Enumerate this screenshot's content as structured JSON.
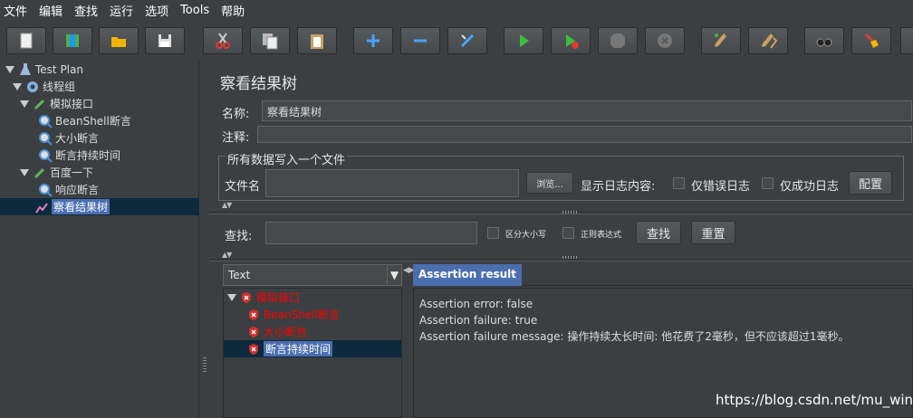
{
  "menu": [
    "文件",
    "编辑",
    "查找",
    "运行",
    "选项",
    "Tools",
    "帮助"
  ],
  "toolbar_icons": [
    "new-icon",
    "template-icon",
    "open-icon",
    "save-icon",
    "cut-icon",
    "copy-icon",
    "paste-icon",
    "expand-icon",
    "collapse-icon",
    "toggle-icon",
    "start-icon",
    "start-no-pause-icon",
    "stop-icon",
    "shutdown-icon",
    "clear-icon",
    "clear-all-icon",
    "search-icon",
    "reset-search-icon"
  ],
  "tree": {
    "test_plan": "Test Plan",
    "thread_group": "线程组",
    "sampler1": "模拟接口",
    "beanshell": "BeanShell断言",
    "size_assert": "大小断言",
    "duration_assert": "断言持续时间",
    "sampler2": "百度一下",
    "response_assert": "响应断言",
    "result_tree": "察看结果树"
  },
  "panel": {
    "title": "察看结果树",
    "name_label": "名称:",
    "name_value": "察看结果树",
    "comment_label": "注释:",
    "comment_value": "",
    "fieldset_legend": "所有数据写入一个文件",
    "filename_label": "文件名",
    "filename_value": "",
    "browse_button": "浏览...",
    "log_display_label": "显示日志内容:",
    "errors_only": "仅错误日志",
    "success_only": "仅成功日志",
    "configure_button": "配置",
    "search_label": "查找:",
    "search_value": "",
    "case_sensitive": "区分大小写",
    "regex": "正则表达式",
    "find_button": "查找",
    "reset_button": "重置"
  },
  "results": {
    "renderer": "Text",
    "tab_label": "Assertion result",
    "items": [
      "模拟接口",
      "BeanShell断言",
      "大小断言",
      "断言持续时间"
    ],
    "lines": [
      "Assertion error: false",
      "Assertion failure: true",
      "Assertion failure message: 操作持续太长时间: 他花费了2毫秒，但不应该超过1毫秒。"
    ]
  },
  "watermark": "https://blog.csdn.net/mu_wind",
  "colors": {
    "background": "#3c3f41",
    "selection": "#4b6eaf",
    "error": "#ff0000"
  }
}
